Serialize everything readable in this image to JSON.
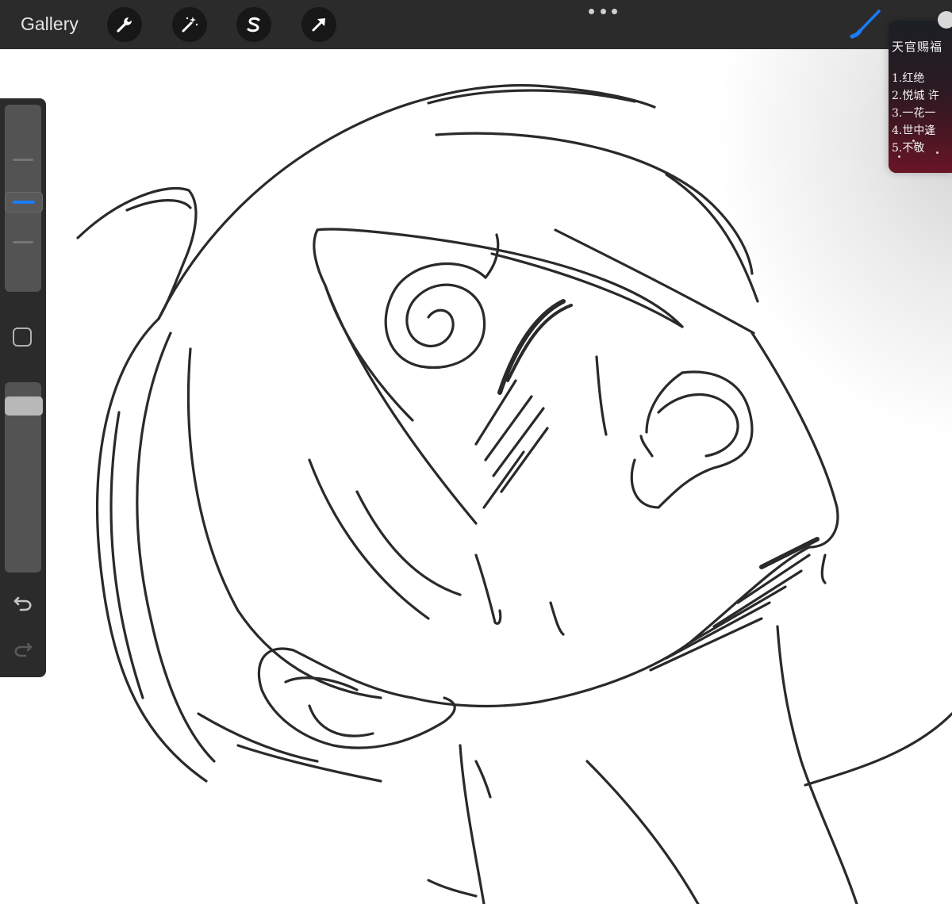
{
  "topbar": {
    "gallery_label": "Gallery",
    "tools": [
      {
        "name": "actions",
        "icon": "wrench-icon"
      },
      {
        "name": "adjustments",
        "icon": "magic-wand-icon"
      },
      {
        "name": "selection",
        "icon": "selection-s-icon"
      },
      {
        "name": "transform",
        "icon": "arrow-cursor-icon"
      }
    ],
    "more_icon": "more-dots-icon",
    "brush_icon": "brush-icon",
    "brush_color": "#1a7cf5"
  },
  "sidebar": {
    "size_slider_icon": "brush-size-slider",
    "modify_icon": "square-modify-icon",
    "opacity_slider_icon": "opacity-slider",
    "undo_icon": "undo-icon",
    "redo_icon": "redo-icon",
    "accent_color": "#1a7cf5"
  },
  "reference": {
    "title": "天官赐福",
    "lines": [
      "1.红绝",
      "2.悦城 许",
      "3.一花一",
      "4.世中逢",
      "5.不敬"
    ]
  },
  "colors": {
    "toolbar_bg": "#2b2b2b",
    "canvas_bg": "#ffffff",
    "ink": "#2a2a2a"
  }
}
